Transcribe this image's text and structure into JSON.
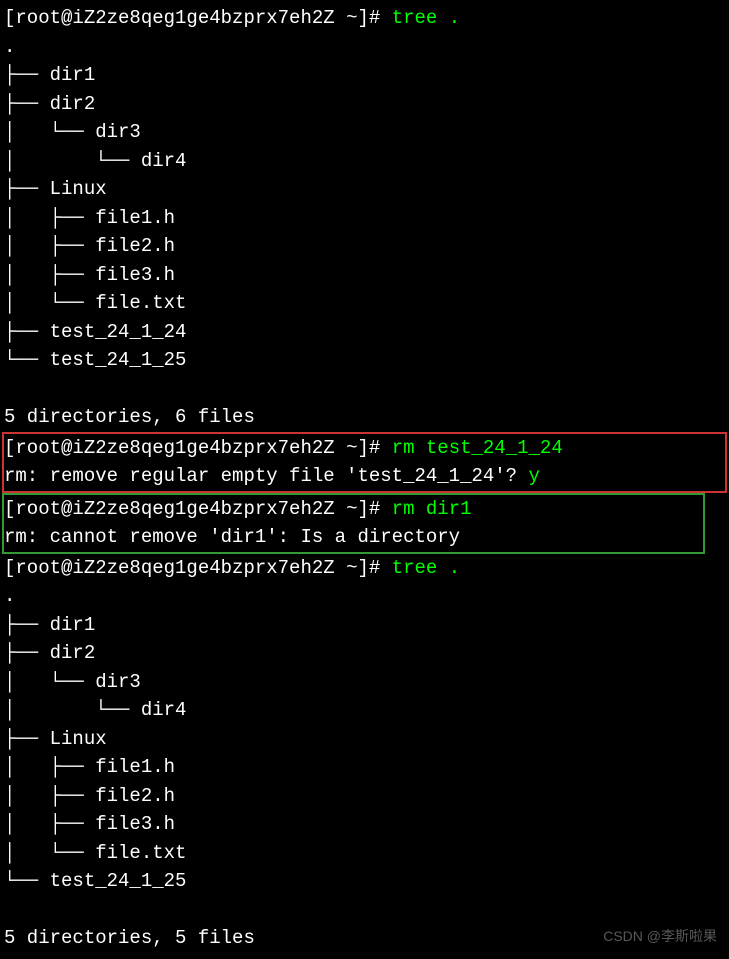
{
  "prompt_user": "root@iZ2ze8qeg1ge4bzprx7eh2Z",
  "prompt_suffix": " ~]# ",
  "commands": {
    "tree1": "tree .",
    "rm_test": "rm test_24_1_24",
    "rm_dir": "rm dir1",
    "tree2": "tree ."
  },
  "output": {
    "dot": ".",
    "tree1": [
      "├── dir1",
      "├── dir2",
      "│   └── dir3",
      "│       └── dir4",
      "├── Linux",
      "│   ├── file1.h",
      "│   ├── file2.h",
      "│   ├── file3.h",
      "│   └── file.txt",
      "├── test_24_1_24",
      "└── test_24_1_25"
    ],
    "summary1": "5 directories, 6 files",
    "rm_prompt_text": "rm: remove regular empty file 'test_24_1_24'? ",
    "rm_answer": "y",
    "rm_error": "rm: cannot remove 'dir1': Is a directory",
    "tree2": [
      "├── dir1",
      "├── dir2",
      "│   └── dir3",
      "│       └── dir4",
      "├── Linux",
      "│   ├── file1.h",
      "│   ├── file2.h",
      "│   ├── file3.h",
      "│   └── file.txt",
      "└── test_24_1_25"
    ],
    "summary2": "5 directories, 5 files"
  },
  "watermark": "CSDN @李斯啦果"
}
